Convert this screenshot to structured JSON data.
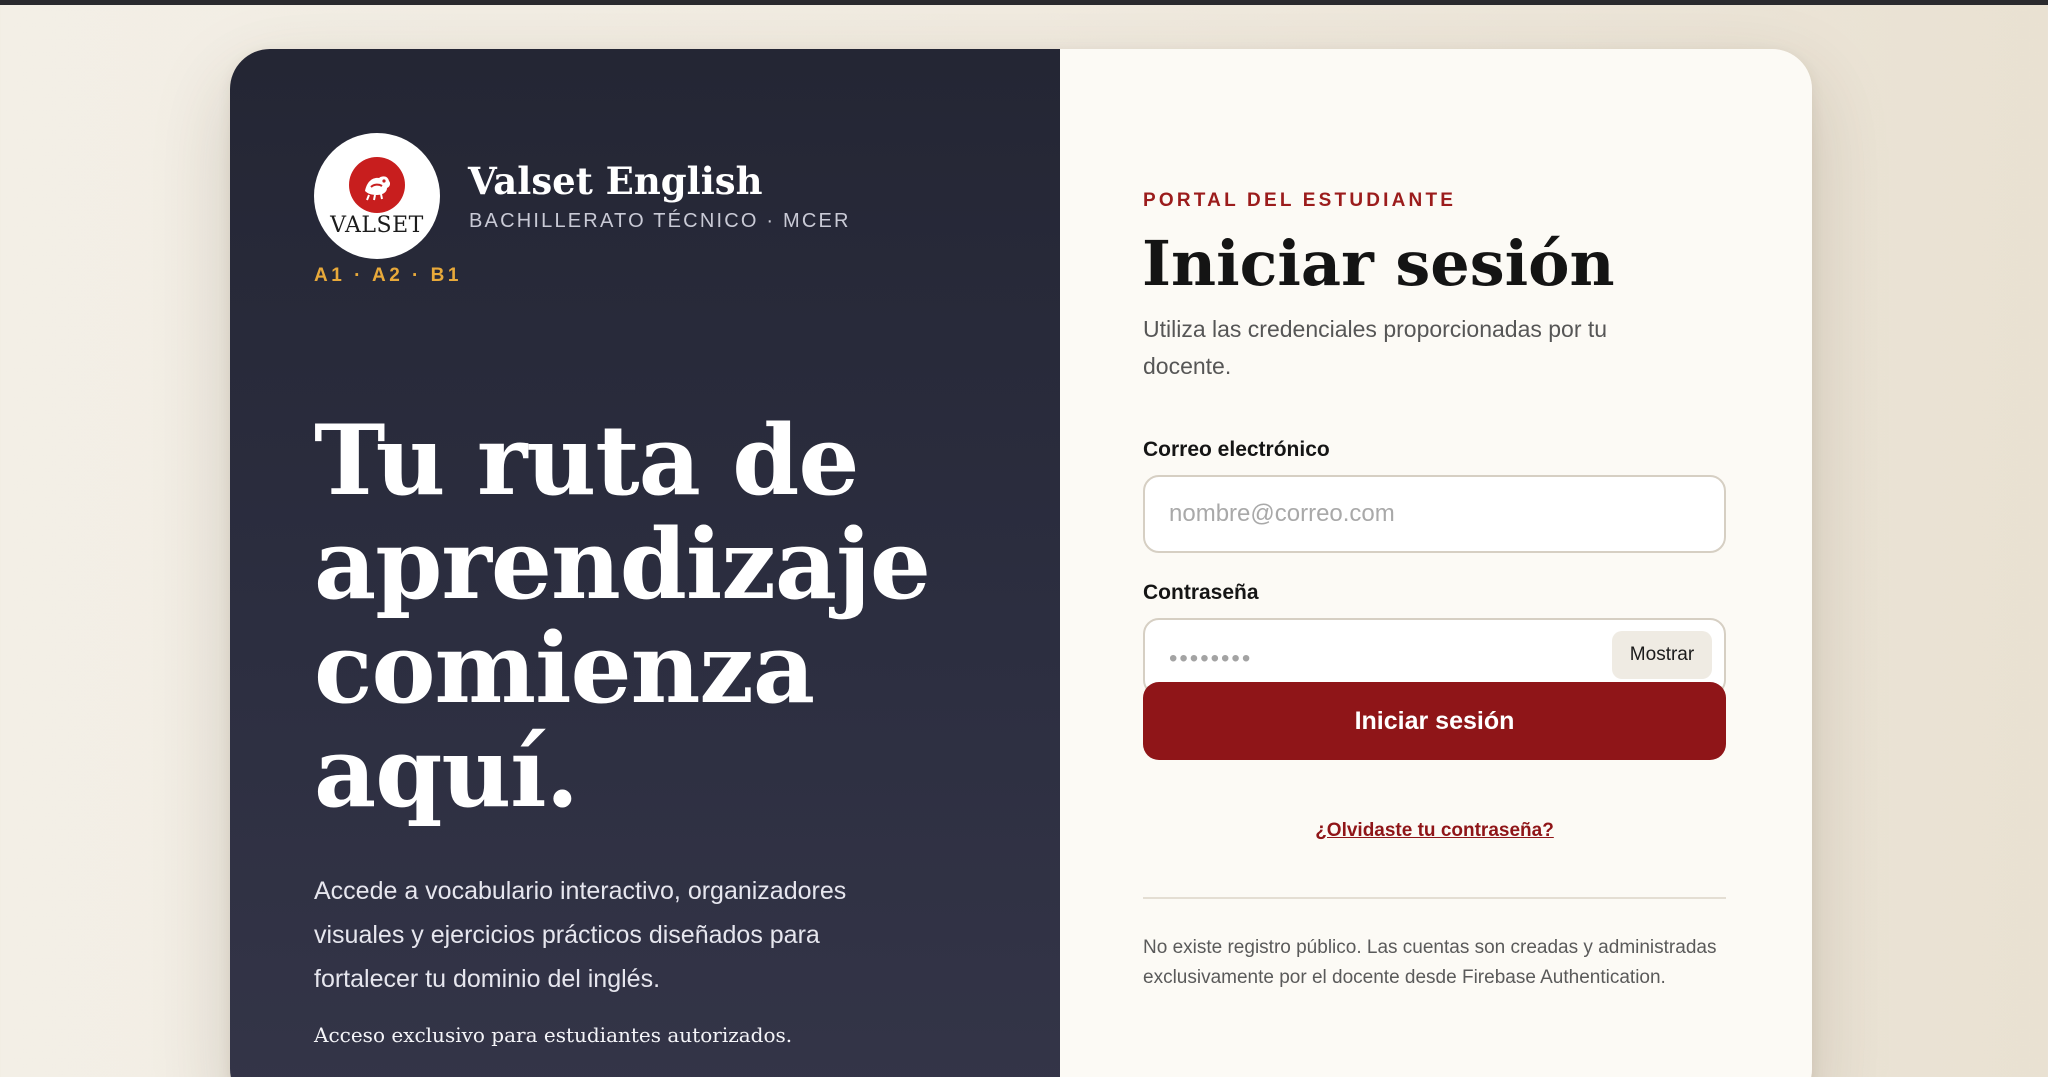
{
  "brand": {
    "logo_text": "VALSET",
    "name": "Valset English",
    "subtitle": "BACHILLERATO TÉCNICO · MCER",
    "levels": "A1 · A2 · B1"
  },
  "hero": {
    "headline": "Tu ruta de aprendizaje comienza aquí.",
    "description": "Accede a vocabulario interactivo, organizadores visuales y ejercicios prácticos diseñados para fortalecer tu dominio del inglés.",
    "exclusive_note": "Acceso exclusivo para estudiantes autorizados."
  },
  "login": {
    "eyebrow": "PORTAL DEL ESTUDIANTE",
    "title": "Iniciar sesión",
    "subtitle": "Utiliza las credenciales proporcionadas por tu docente.",
    "email_label": "Correo electrónico",
    "email_placeholder": "nombre@correo.com",
    "email_value": "",
    "password_label": "Contraseña",
    "password_placeholder": "••••••••",
    "show_button": "Mostrar",
    "submit_button": "Iniciar sesión",
    "forgot_link": "¿Olvidaste tu contraseña?",
    "footer_note": "No existe registro público. Las cuentas son creadas y administradas exclusivamente por el docente desde Firebase Authentication."
  },
  "colors": {
    "accent": "#8f1518",
    "left_panel": "#2a2c3d",
    "levels": "#e8a93a",
    "logo_red": "#c81e1e"
  },
  "icons": {
    "logo": "valset-emblem-icon"
  }
}
